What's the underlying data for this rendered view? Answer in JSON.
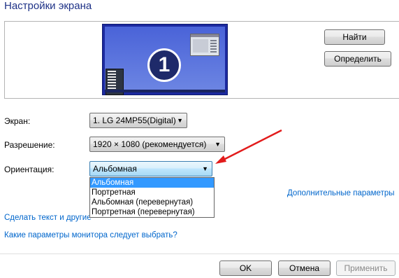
{
  "window": {
    "title": "Настройки экрана"
  },
  "monitor": {
    "number": "1"
  },
  "buttons": {
    "find": "Найти",
    "identify": "Определить",
    "ok": "OK",
    "cancel": "Отмена",
    "apply": "Применить"
  },
  "fields": {
    "screen": {
      "label": "Экран:",
      "value": "1. LG 24MP55(Digital)"
    },
    "resolution": {
      "label": "Разрешение:",
      "value": "1920 × 1080 (рекомендуется)"
    },
    "orientation": {
      "label": "Ориентация:",
      "value": "Альбомная",
      "options": [
        "Альбомная",
        "Портретная",
        "Альбомная (перевернутая)",
        "Портретная (перевернутая)"
      ],
      "selected_index": 0
    }
  },
  "links": {
    "advanced": "Дополнительные параметры",
    "text_size": "Сделать текст и другие",
    "which_settings": "Какие параметры монитора следует выбрать?"
  },
  "annotation": {
    "arrow_color": "#e21b1b"
  }
}
